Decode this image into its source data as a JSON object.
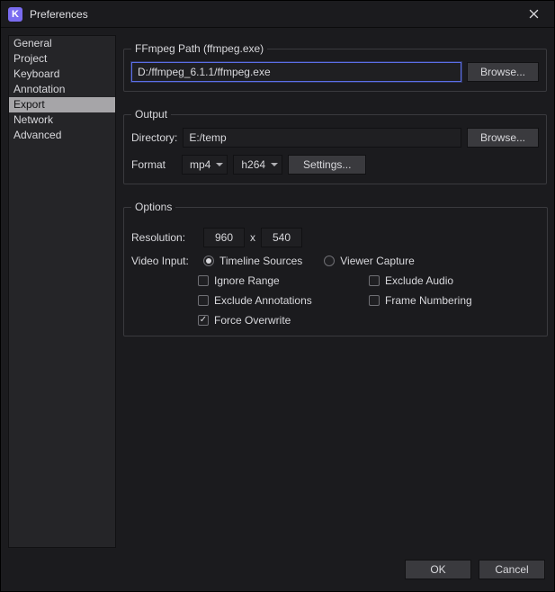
{
  "window": {
    "title": "Preferences",
    "logo_letter": "K"
  },
  "sidebar": {
    "items": [
      {
        "label": "General",
        "selected": false
      },
      {
        "label": "Project",
        "selected": false
      },
      {
        "label": "Keyboard",
        "selected": false
      },
      {
        "label": "Annotation",
        "selected": false
      },
      {
        "label": "Export",
        "selected": true
      },
      {
        "label": "Network",
        "selected": false
      },
      {
        "label": "Advanced",
        "selected": false
      }
    ]
  },
  "groups": {
    "ffmpeg": {
      "legend": "FFmpeg Path (ffmpeg.exe)",
      "path_value": "D:/ffmpeg_6.1.1/ffmpeg.exe",
      "browse_label": "Browse..."
    },
    "output": {
      "legend": "Output",
      "directory_label": "Directory:",
      "directory_value": "E:/temp",
      "browse_label": "Browse...",
      "format_label": "Format",
      "container_value": "mp4",
      "codec_value": "h264",
      "settings_label": "Settings..."
    },
    "options": {
      "legend": "Options",
      "resolution_label": "Resolution:",
      "resolution_w": "960",
      "resolution_sep": "x",
      "resolution_h": "540",
      "video_input_label": "Video Input:",
      "radio_timeline_label": "Timeline Sources",
      "radio_viewer_label": "Viewer Capture",
      "radio_selected": "timeline",
      "checks": {
        "ignore_range": {
          "label": "Ignore Range",
          "checked": false
        },
        "exclude_audio": {
          "label": "Exclude Audio",
          "checked": false
        },
        "exclude_annotations": {
          "label": "Exclude Annotations",
          "checked": false
        },
        "frame_numbering": {
          "label": "Frame Numbering",
          "checked": false
        },
        "force_overwrite": {
          "label": "Force Overwrite",
          "checked": true
        }
      }
    }
  },
  "footer": {
    "ok_label": "OK",
    "cancel_label": "Cancel"
  }
}
